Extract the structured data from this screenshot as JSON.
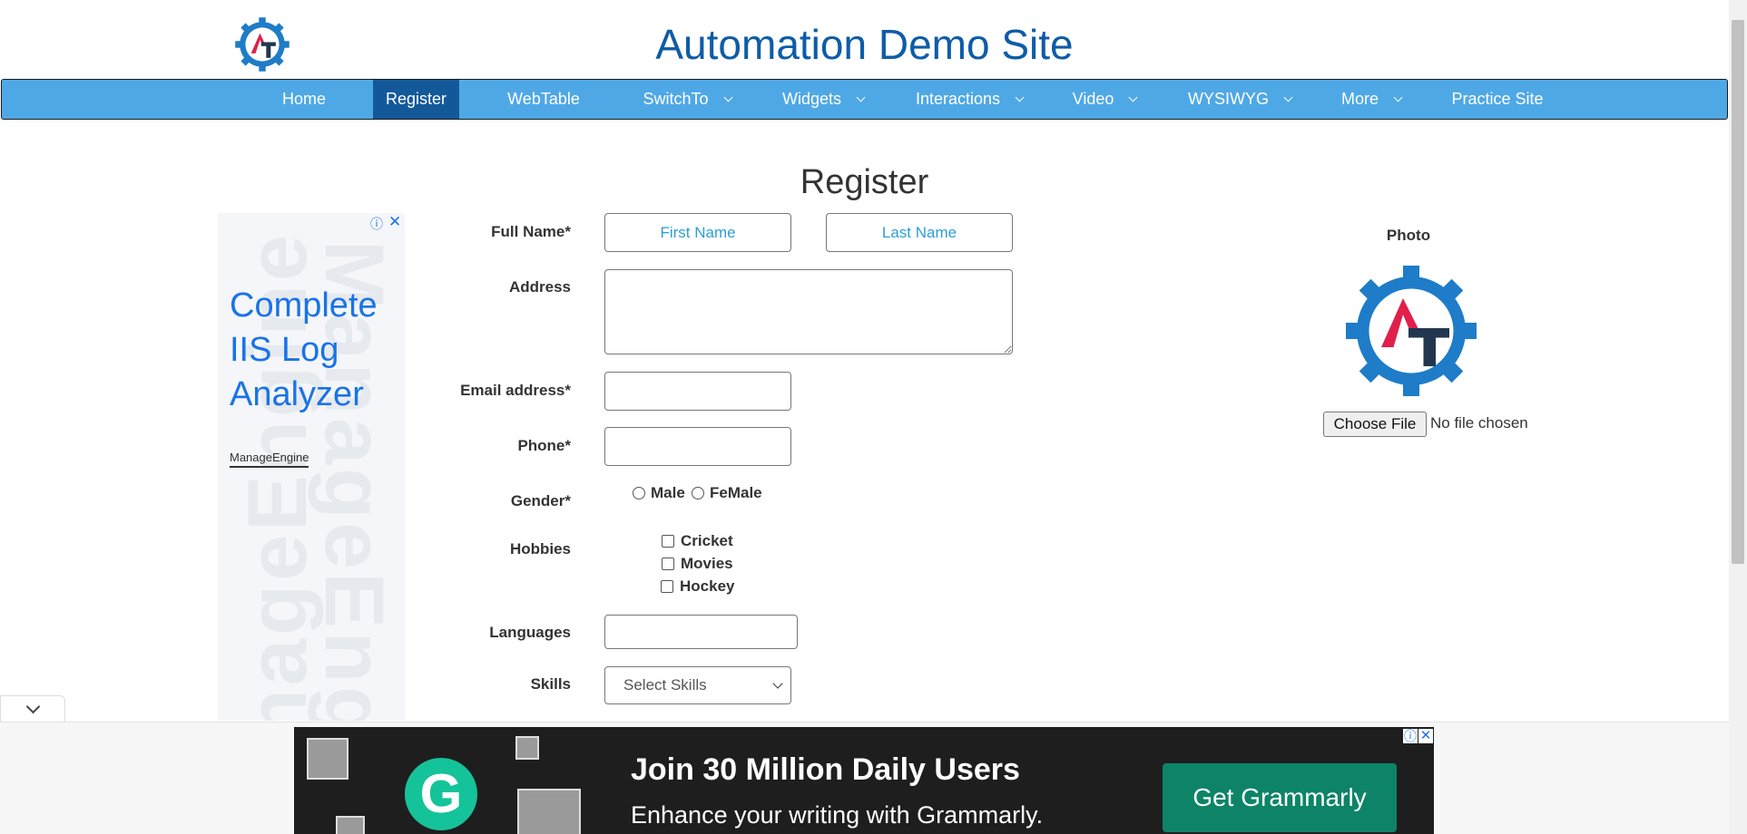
{
  "site": {
    "title": "Automation Demo Site"
  },
  "nav": {
    "items": [
      {
        "label": "Home"
      },
      {
        "label": "Register"
      },
      {
        "label": "WebTable"
      },
      {
        "label": "SwitchTo"
      },
      {
        "label": "Widgets"
      },
      {
        "label": "Interactions"
      },
      {
        "label": "Video"
      },
      {
        "label": "WYSIWYG"
      },
      {
        "label": "More"
      },
      {
        "label": "Practice Site"
      }
    ],
    "active": "Register"
  },
  "page": {
    "heading": "Register"
  },
  "form": {
    "full_name_label": "Full Name*",
    "first_name_placeholder": "First Name",
    "last_name_placeholder": "Last Name",
    "address_label": "Address",
    "email_label": "Email address*",
    "phone_label": "Phone*",
    "gender_label": "Gender*",
    "gender_options": [
      "Male",
      "FeMale"
    ],
    "hobbies_label": "Hobbies",
    "hobbies": [
      "Cricket",
      "Movies",
      "Hockey"
    ],
    "languages_label": "Languages",
    "skills_label": "Skills",
    "skills_selected": "Select Skills"
  },
  "photo": {
    "label": "Photo",
    "choose_file": "Choose File",
    "status": "No file chosen"
  },
  "side_ad": {
    "headline": "Complete IIS Log Analyzer",
    "brand": "ManageEngine",
    "watermark": "ManageEngine",
    "info_icon": "ⓘ",
    "close_icon": "✕"
  },
  "banner_ad": {
    "headline": "Join 30 Million Daily Users",
    "subtext": "Enhance your writing with Grammarly.",
    "cta": "Get Grammarly",
    "logo_letter": "G",
    "info_icon": "ⓘ",
    "close_icon": "✕"
  },
  "colors": {
    "nav_bg": "#4fa8e6",
    "nav_active": "#13599a",
    "title": "#0e5ca8",
    "placeholder": "#2a9fd8",
    "ad_headline": "#1a73e8",
    "banner_bg": "#1e1e1e",
    "cta_bg": "#0d8467",
    "grammarly_green": "#15c39a"
  }
}
